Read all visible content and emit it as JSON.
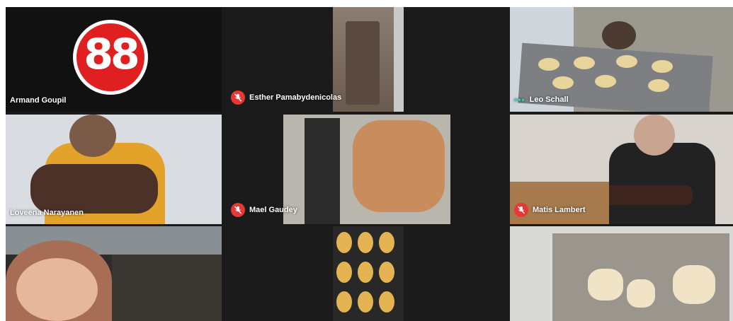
{
  "meeting": {
    "participants": [
      {
        "name": "Armand Goupil",
        "muted": false,
        "avatar_text": "88"
      },
      {
        "name": "Esther Pamabydenicolas",
        "muted": true
      },
      {
        "name": "Leo Schall",
        "muted": false,
        "speaking": true
      },
      {
        "name": "Loveena Narayanen",
        "muted": false
      },
      {
        "name": "Mael Gaudey",
        "muted": true
      },
      {
        "name": "Matis Lambert",
        "muted": true
      },
      {
        "name": "",
        "muted": false
      },
      {
        "name": "",
        "muted": true
      },
      {
        "name": "",
        "muted": true
      }
    ],
    "icons": {
      "muted": "mic-off-icon",
      "speaking": "speaking-dots-icon"
    },
    "colors": {
      "mute_badge": "#e53935",
      "speaking": "#34d1bf",
      "tile_bg": "#202124",
      "logo_red": "#e02020"
    }
  }
}
